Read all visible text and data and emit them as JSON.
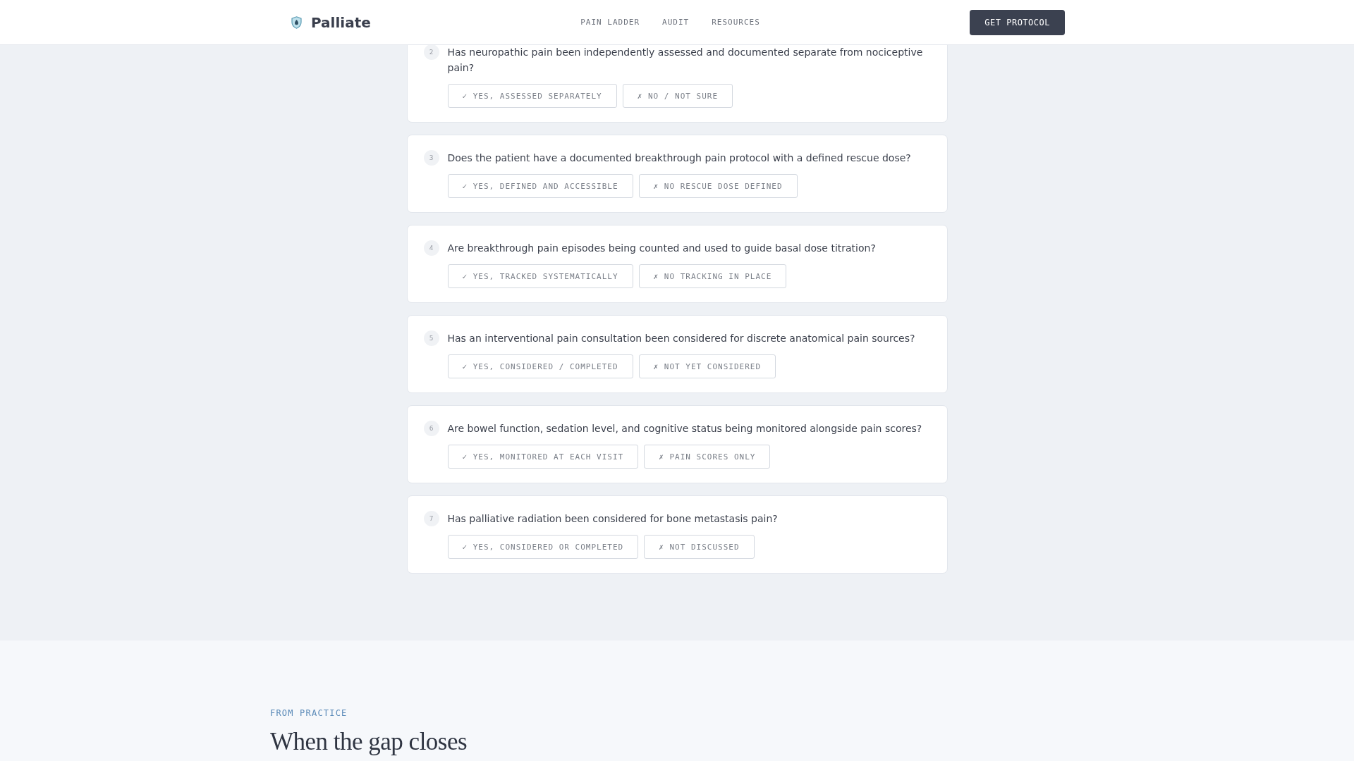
{
  "header": {
    "brand": "Palliate",
    "nav": [
      "PAIN LADDER",
      "AUDIT",
      "RESOURCES"
    ],
    "cta": "GET PROTOCOL"
  },
  "questions": [
    {
      "number": "2",
      "text": "Has neuropathic pain been independently assessed and documented separate from nociceptive pain?",
      "options": [
        {
          "label": "✓ YES, ASSESSED SEPARATELY",
          "selected": false
        },
        {
          "label": "✗ NO / NOT SURE",
          "selected": false
        }
      ]
    },
    {
      "number": "3",
      "text": "Does the patient have a documented breakthrough pain protocol with a defined rescue dose?",
      "options": [
        {
          "label": "✓ YES, DEFINED AND ACCESSIBLE",
          "selected": false
        },
        {
          "label": "✗ NO RESCUE DOSE DEFINED",
          "selected": false
        }
      ]
    },
    {
      "number": "4",
      "text": "Are breakthrough pain episodes being counted and used to guide basal dose titration?",
      "options": [
        {
          "label": "✓ YES, TRACKED SYSTEMATICALLY",
          "selected": false
        },
        {
          "label": "✗ NO TRACKING IN PLACE",
          "selected": false
        }
      ]
    },
    {
      "number": "5",
      "text": "Has an interventional pain consultation been considered for discrete anatomical pain sources?",
      "options": [
        {
          "label": "✓ YES, CONSIDERED / COMPLETED",
          "selected": false
        },
        {
          "label": "✗ NOT YET CONSIDERED",
          "selected": false
        }
      ]
    },
    {
      "number": "6",
      "text": "Are bowel function, sedation level, and cognitive status being monitored alongside pain scores?",
      "options": [
        {
          "label": "✓ YES, MONITORED AT EACH VISIT",
          "selected": false
        },
        {
          "label": "✗ PAIN SCORES ONLY",
          "selected": false
        }
      ]
    },
    {
      "number": "7",
      "text": "Has palliative radiation been considered for bone metastasis pain?",
      "options": [
        {
          "label": "✓ YES, CONSIDERED OR COMPLETED",
          "selected": false
        },
        {
          "label": "✗ NOT DISCUSSED",
          "selected": false
        }
      ]
    }
  ],
  "next_section": {
    "eyebrow": "FROM PRACTICE",
    "heading": "When the gap closes"
  }
}
